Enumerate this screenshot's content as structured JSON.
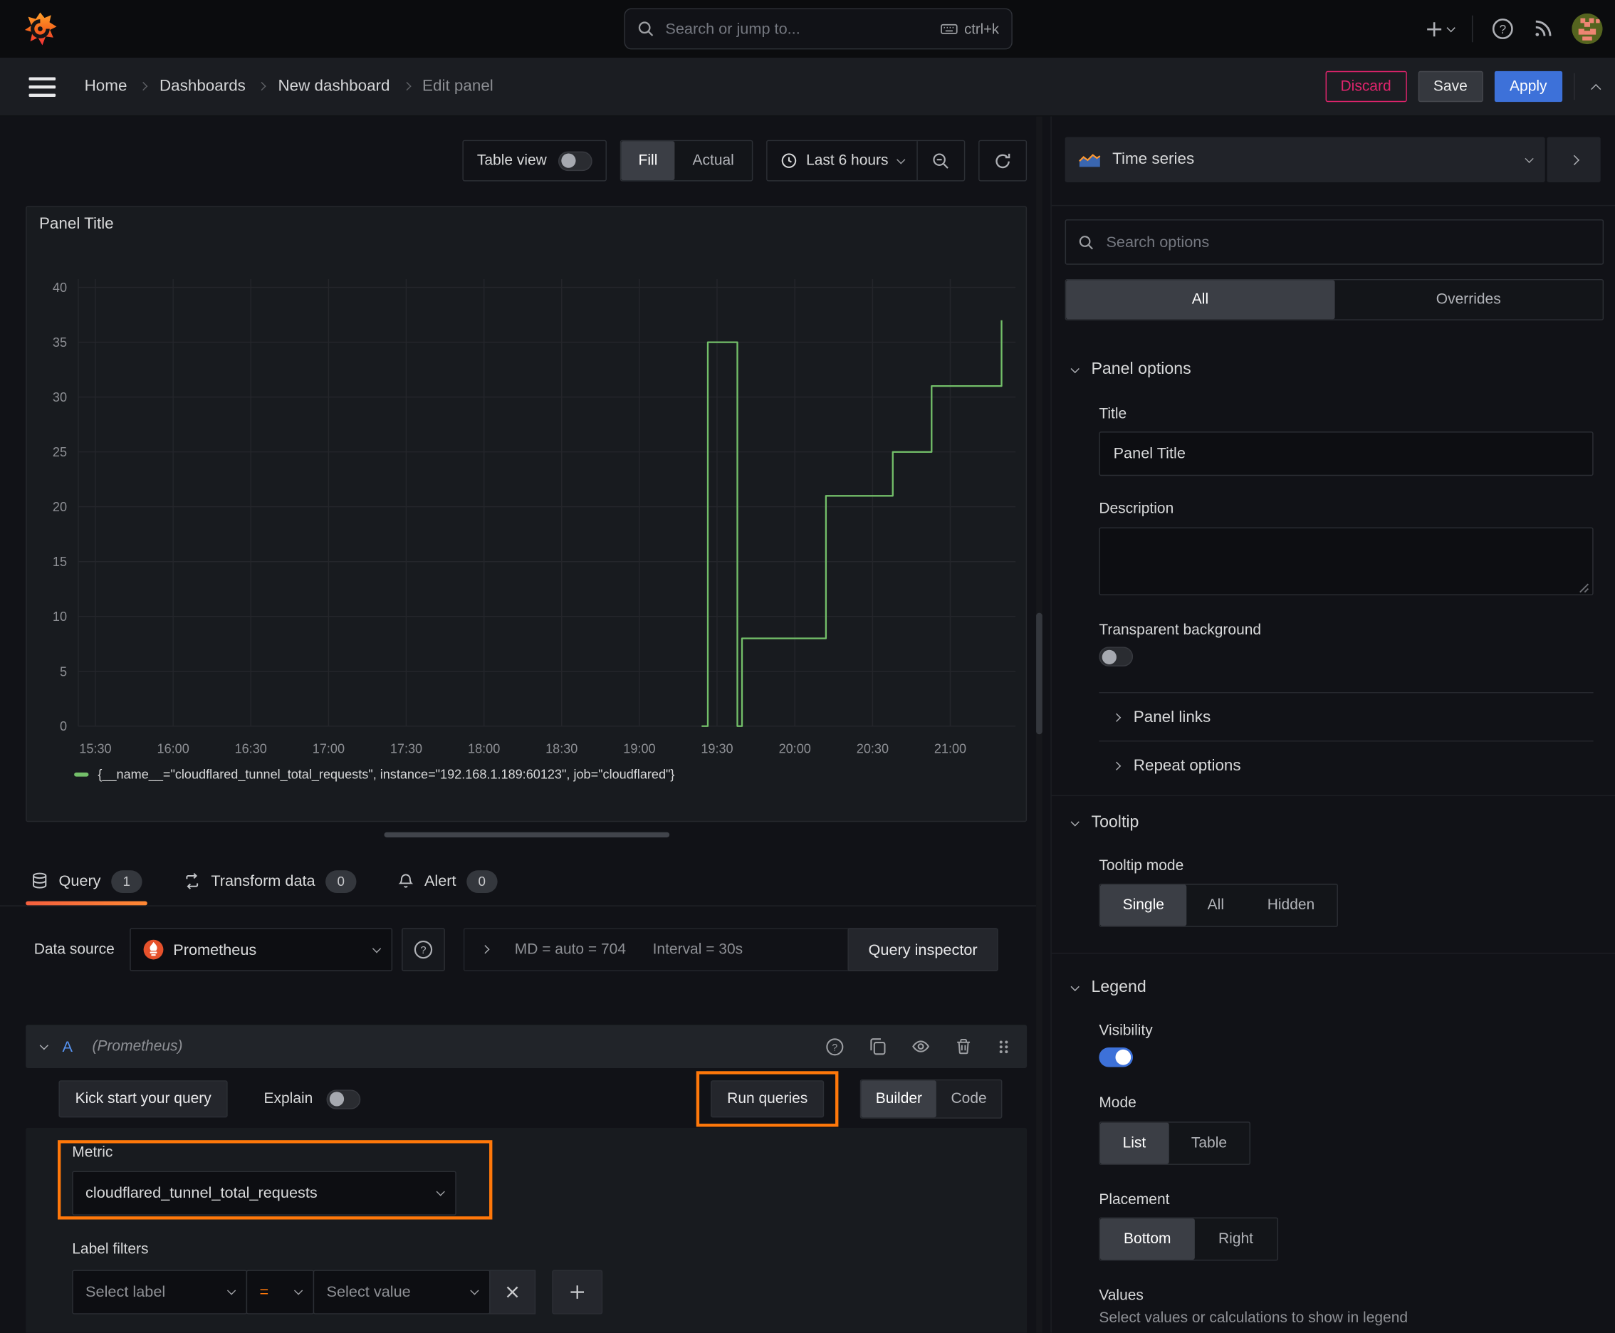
{
  "topbar": {
    "search_placeholder": "Search or jump to...",
    "search_shortcut": "ctrl+k"
  },
  "breadcrumbs": {
    "items": [
      "Home",
      "Dashboards",
      "New dashboard",
      "Edit panel"
    ]
  },
  "nav_actions": {
    "discard": "Discard",
    "save": "Save",
    "apply": "Apply"
  },
  "toolbar": {
    "table_view": "Table view",
    "fill": "Fill",
    "actual": "Actual",
    "time_range": "Last 6 hours"
  },
  "panel": {
    "title": "Panel Title"
  },
  "chart_data": {
    "type": "line",
    "title": "Panel Title",
    "style": "step-line",
    "series": [
      {
        "name": "{__name__=\"cloudflared_tunnel_total_requests\", instance=\"192.168.1.189:60123\", job=\"cloudflared\"}",
        "color": "#73bf69",
        "points": [
          [
            19.4,
            0
          ],
          [
            19.44,
            0
          ],
          [
            19.44,
            35
          ],
          [
            19.63,
            35
          ],
          [
            19.63,
            0
          ],
          [
            19.66,
            0
          ],
          [
            19.66,
            8
          ],
          [
            20.2,
            8
          ],
          [
            20.2,
            21
          ],
          [
            20.63,
            21
          ],
          [
            20.63,
            25
          ],
          [
            20.88,
            25
          ],
          [
            20.88,
            31
          ],
          [
            21.33,
            31
          ],
          [
            21.33,
            37
          ]
        ]
      }
    ],
    "xlim": [
      15.39,
      21.42
    ],
    "ylim": [
      0,
      40
    ],
    "y_ticks": [
      0,
      5,
      10,
      15,
      20,
      25,
      30,
      35,
      40
    ],
    "x_ticks": [
      {
        "t": 15.5,
        "label": "15:30"
      },
      {
        "t": 16.0,
        "label": "16:00"
      },
      {
        "t": 16.5,
        "label": "16:30"
      },
      {
        "t": 17.0,
        "label": "17:00"
      },
      {
        "t": 17.5,
        "label": "17:30"
      },
      {
        "t": 18.0,
        "label": "18:00"
      },
      {
        "t": 18.5,
        "label": "18:30"
      },
      {
        "t": 19.0,
        "label": "19:00"
      },
      {
        "t": 19.5,
        "label": "19:30"
      },
      {
        "t": 20.0,
        "label": "20:00"
      },
      {
        "t": 20.5,
        "label": "20:30"
      },
      {
        "t": 21.0,
        "label": "21:00"
      }
    ],
    "grid": true,
    "legend_position": "bottom"
  },
  "tabs": {
    "query": {
      "label": "Query",
      "count": "1"
    },
    "transform": {
      "label": "Transform data",
      "count": "0"
    },
    "alert": {
      "label": "Alert",
      "count": "0"
    }
  },
  "datasource_row": {
    "label": "Data source",
    "name": "Prometheus",
    "max_data_points": "MD = auto = 704",
    "interval": "Interval = 30s",
    "inspector": "Query inspector"
  },
  "query_editor": {
    "ref_id": "A",
    "ds_hint": "(Prometheus)",
    "kick_start": "Kick start your query",
    "explain": "Explain",
    "run_queries": "Run queries",
    "builder": "Builder",
    "code": "Code",
    "metric_label": "Metric",
    "metric_value": "cloudflared_tunnel_total_requests",
    "label_filters": "Label filters",
    "select_label": "Select label",
    "operator": "=",
    "select_value": "Select value"
  },
  "options_pane": {
    "viz_type": "Time series",
    "search_placeholder": "Search options",
    "tab_all": "All",
    "tab_overrides": "Overrides",
    "panel_options": {
      "header": "Panel options",
      "title_label": "Title",
      "title_value": "Panel Title",
      "description_label": "Description",
      "transparent_label": "Transparent background",
      "panel_links": "Panel links",
      "repeat_options": "Repeat options"
    },
    "tooltip": {
      "header": "Tooltip",
      "mode_label": "Tooltip mode",
      "single": "Single",
      "all": "All",
      "hidden": "Hidden"
    },
    "legend": {
      "header": "Legend",
      "visibility_label": "Visibility",
      "mode_label": "Mode",
      "list": "List",
      "table": "Table",
      "placement_label": "Placement",
      "bottom": "Bottom",
      "right": "Right",
      "values_label": "Values",
      "values_help": "Select values or calculations to show in legend"
    }
  },
  "colors": {
    "accent_orange": "#ff780a",
    "apply_blue": "#3d71d9",
    "discard_pink": "#e0246d",
    "series_green": "#73bf69"
  }
}
